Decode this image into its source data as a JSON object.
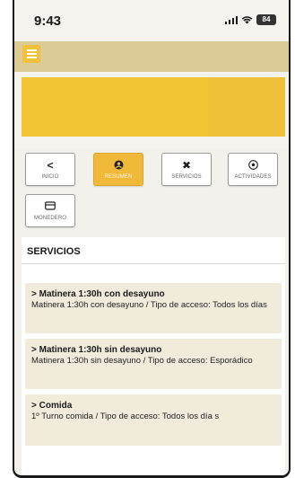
{
  "status_bar": {
    "time": "9:43",
    "battery": "84"
  },
  "topbar": {
    "menu_icon": "hamburger-icon",
    "accent_color": "#f1c13a"
  },
  "nav": {
    "items": [
      {
        "label": "INICIO",
        "icon": "chevron-left-icon",
        "glyph": "<",
        "active": false
      },
      {
        "label": "RESUMEN",
        "icon": "user-icon",
        "glyph": "●",
        "active": true
      },
      {
        "label": "SERVICIOS",
        "icon": "tools-icon",
        "glyph": "✖",
        "active": false
      },
      {
        "label": "ACTIVIDADES",
        "icon": "soccer-ball-icon",
        "glyph": "⚽",
        "active": false
      },
      {
        "label": "MONEDERO",
        "icon": "wallet-icon",
        "glyph": "▭",
        "active": false
      }
    ]
  },
  "services": {
    "title": "SERVICIOS",
    "cards": [
      {
        "title": "> Matinera 1:30h con desayuno",
        "description": "Matinera 1:30h con desayuno / Tipo de acceso: Todos los días"
      },
      {
        "title": "> Matinera 1:30h sin desayuno",
        "description": "Matinera 1:30h sin desayuno / Tipo de acceso: Esporádico"
      },
      {
        "title": "> Comida",
        "description": "1º Turno comida / Tipo de acceso: Todos los día s"
      }
    ]
  },
  "colors": {
    "banner": "#f0c138",
    "topbar": "#dccb97",
    "active_tile": "#f0b93a",
    "card_bg": "#f1ebdb"
  }
}
